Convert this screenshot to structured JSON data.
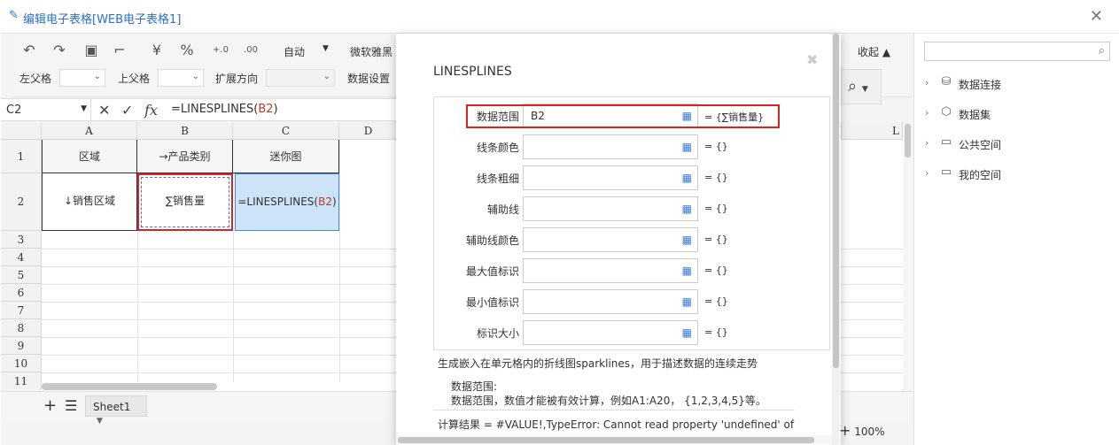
{
  "window": {
    "title": "编辑电子表格[WEB电子表格1]"
  },
  "toolbar": {
    "auto_label": "自动",
    "font_label": "微软雅黑",
    "left_parent_label": "左父格",
    "top_parent_label": "上父格",
    "expand_dir_label": "扩展方向",
    "data_settings_label": "数据设置",
    "yen": "¥",
    "percent": "%",
    "collapse_label": "收起"
  },
  "formula_bar": {
    "cell_ref": "C2",
    "formula_prefix": "=LINESPLINES(",
    "formula_ref": "B2",
    "formula_suffix": ")"
  },
  "grid": {
    "columns": [
      "A",
      "B",
      "C",
      "D",
      "L"
    ],
    "rows": [
      "1",
      "2",
      "3",
      "4",
      "5",
      "6",
      "7",
      "8",
      "9",
      "10",
      "11"
    ],
    "a1": "区域",
    "b1": "→产品类别",
    "c1": "迷你图",
    "a2": "↓销售区域",
    "b2": "∑销售量",
    "c2_prefix": "=LINESPLINES(",
    "c2_ref": "B2",
    "c2_suffix": ")"
  },
  "sheets": {
    "tab": "Sheet1",
    "add": "+",
    "list": "☰"
  },
  "right_panel": {
    "search_placeholder": "",
    "items": [
      {
        "label": "数据连接",
        "icon": "database-icon"
      },
      {
        "label": "数据集",
        "icon": "cube-icon"
      },
      {
        "label": "公共空间",
        "icon": "folder-icon"
      },
      {
        "label": "我的空间",
        "icon": "user-folder-icon"
      }
    ]
  },
  "dialog": {
    "title": "LINESPLINES",
    "params": [
      {
        "label": "数据范围",
        "value": "B2",
        "result": "= {∑销售量}"
      },
      {
        "label": "线条颜色",
        "value": "",
        "result": "= {}"
      },
      {
        "label": "线条粗细",
        "value": "",
        "result": "= {}"
      },
      {
        "label": "辅助线",
        "value": "",
        "result": "= {}"
      },
      {
        "label": "辅助线颜色",
        "value": "",
        "result": "= {}"
      },
      {
        "label": "最大值标识",
        "value": "",
        "result": "= {}"
      },
      {
        "label": "最小值标识",
        "value": "",
        "result": "= {}"
      },
      {
        "label": "标识大小",
        "value": "",
        "result": "= {}"
      }
    ],
    "description": "生成嵌入在单元格内的折线图sparklines，用于描述数据的连续走势",
    "param_title": "数据范围:",
    "param_desc": "数据范围，数值才能被有效计算，例如A1:A20， {1,2,3,4,5}等。",
    "result": "计算结果 = #VALUE!,TypeError: Cannot read property 'undefined' of"
  },
  "zoom": {
    "level": "100%"
  }
}
